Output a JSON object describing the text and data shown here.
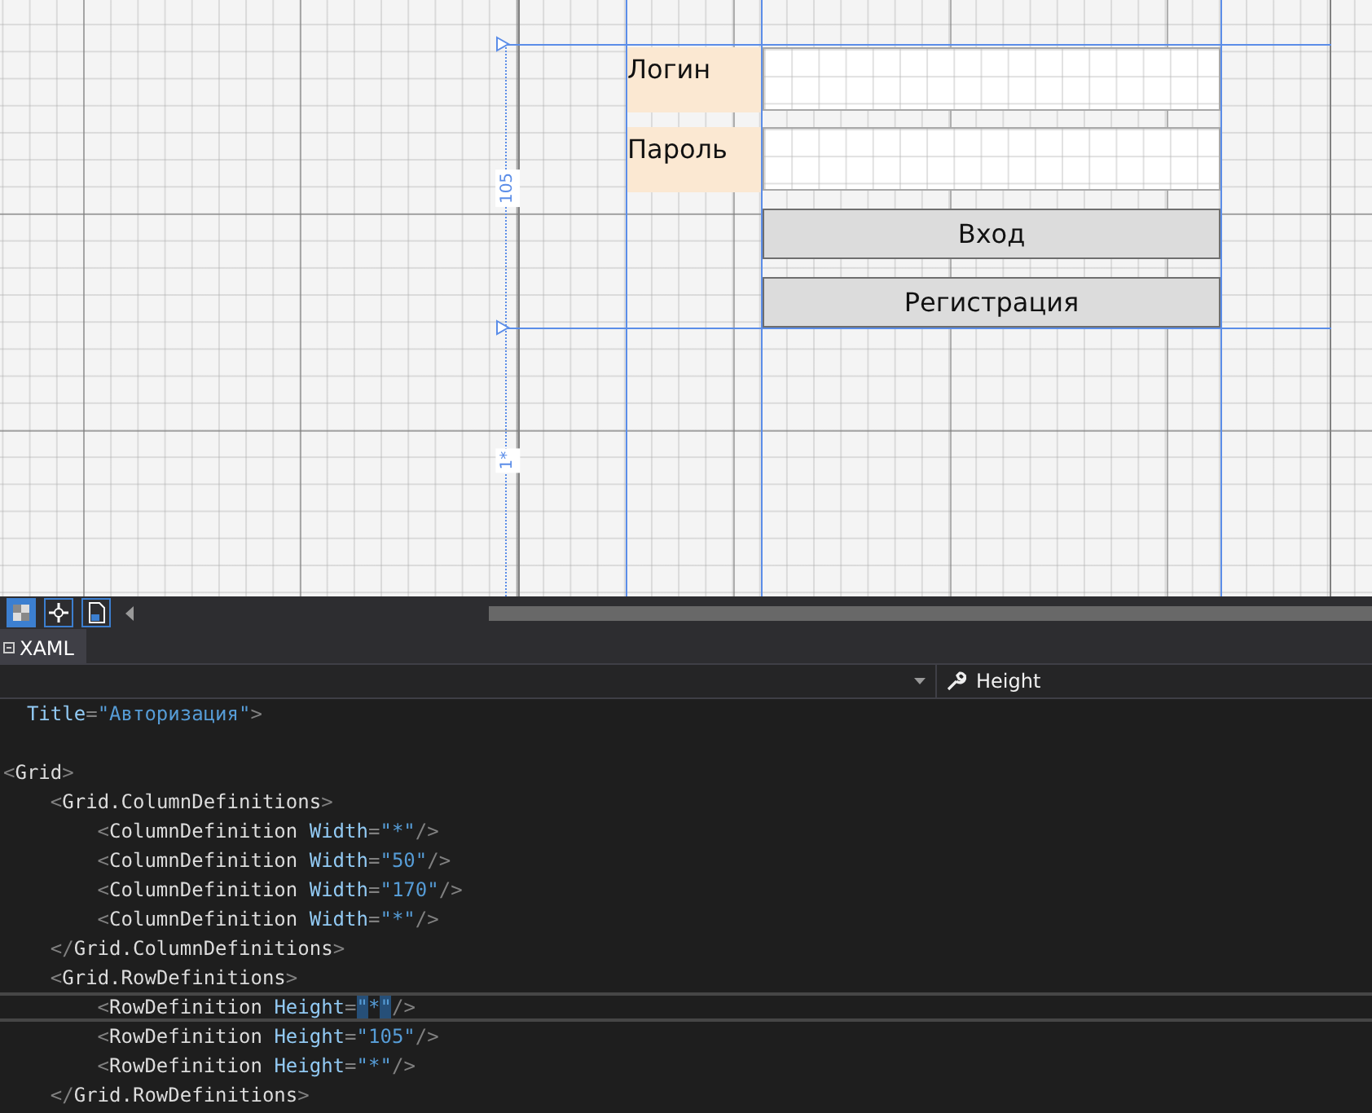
{
  "designer": {
    "labels": [
      "Логин",
      "Пароль"
    ],
    "textboxes": [
      {
        "kind": "textbox"
      },
      {
        "kind": "textbox"
      }
    ],
    "buttons": [
      "Вход",
      "Регистрация"
    ],
    "row_sizes": [
      "105",
      "1*"
    ]
  },
  "toolbar": {
    "buttons": [
      {
        "selected": true
      },
      {
        "selected": false
      },
      {
        "selected": false
      }
    ]
  },
  "tabs": [
    {
      "label": "XAML",
      "selected": true
    }
  ],
  "navigation_bar": {
    "member": "Height"
  },
  "code": {
    "lines": [
      {
        "text": "  Title=\"Авторизация\">",
        "current": false
      },
      {
        "current": false
      },
      {
        "text": "<Grid>",
        "current": false
      },
      {
        "text": "    <Grid.ColumnDefinitions>",
        "current": false
      },
      {
        "text": "        <ColumnDefinition Width=\"*\"/>",
        "current": false
      },
      {
        "text": "        <ColumnDefinition Width=\"50\"/>",
        "current": false
      },
      {
        "text": "        <ColumnDefinition Width=\"170\"/>",
        "current": false
      },
      {
        "text": "        <ColumnDefinition Width=\"*\"/>",
        "current": false
      },
      {
        "text": "    </Grid.ColumnDefinitions>",
        "current": false
      },
      {
        "text": "    <Grid.RowDefinitions>",
        "current": false
      },
      {
        "text": "        <RowDefinition Height=\"*\"/>",
        "current": true
      },
      {
        "text": "        <RowDefinition Height=\"105\"/>",
        "current": false
      },
      {
        "text": "        <RowDefinition Height=\"*\"/>",
        "current": false
      },
      {
        "text": "    </Grid.RowDefinitions>",
        "current": false
      }
    ]
  }
}
